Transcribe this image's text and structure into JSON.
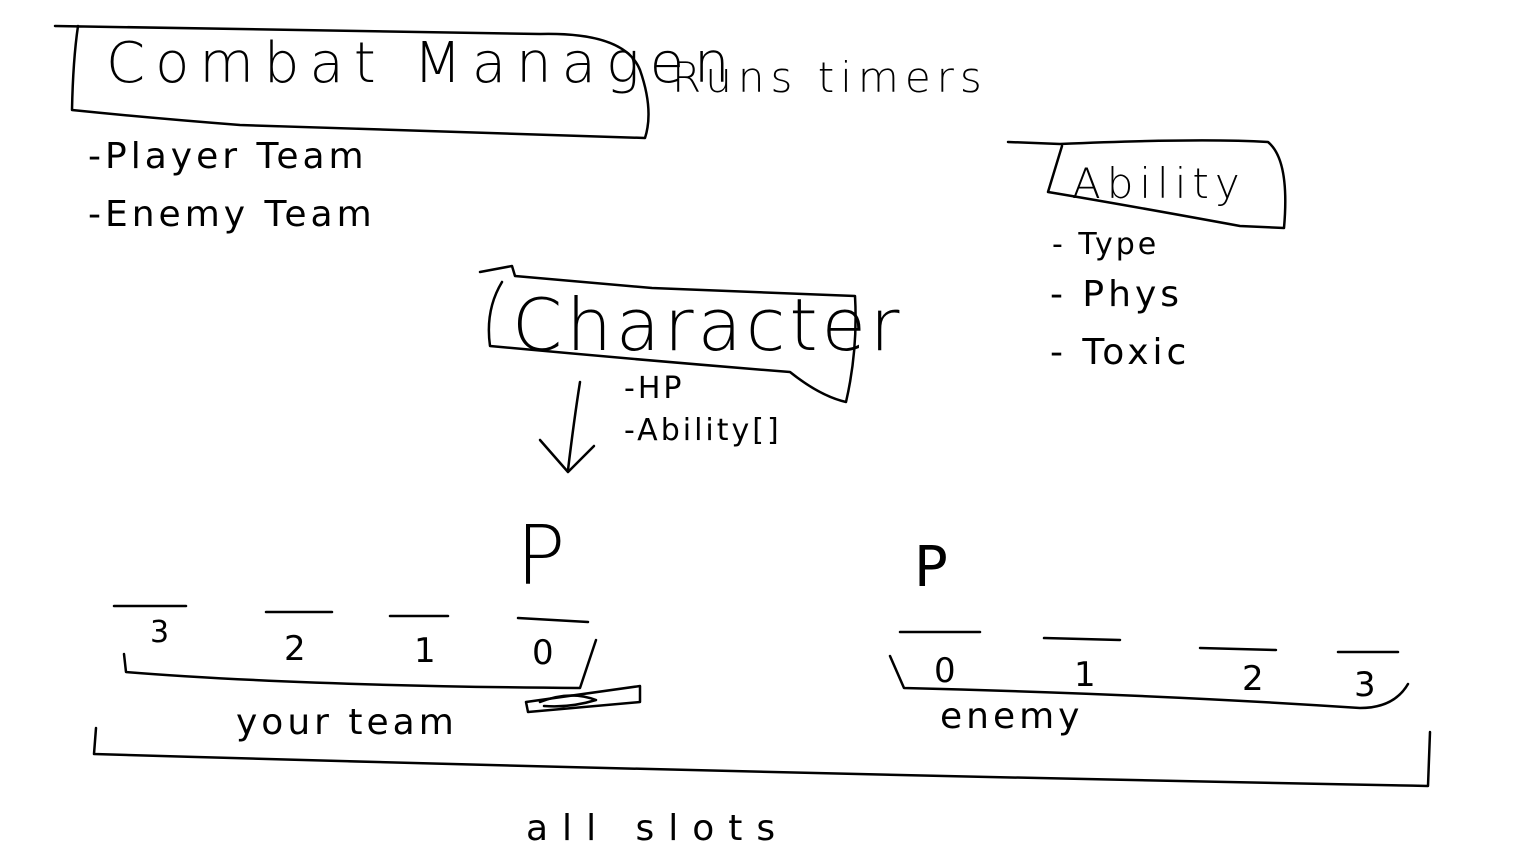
{
  "combat_manager": {
    "title": "Combat Managen",
    "note": "Runs timers",
    "fields": [
      "-Player Team",
      "-Enemy Team"
    ]
  },
  "ability": {
    "title": "Ability",
    "fields": [
      "- Type",
      "- Phys",
      "- Toxic"
    ]
  },
  "character": {
    "title": "Character",
    "fields": [
      "-HP",
      "-Ability[]"
    ]
  },
  "player_marker": "P",
  "enemy_marker": "P",
  "your_team": {
    "slots": [
      "3",
      "2",
      "1",
      "0"
    ],
    "label": "your team"
  },
  "enemy_team": {
    "slots": [
      "0",
      "1",
      "2",
      "3"
    ],
    "label": "enemy"
  },
  "all_slots_label": "all slots"
}
